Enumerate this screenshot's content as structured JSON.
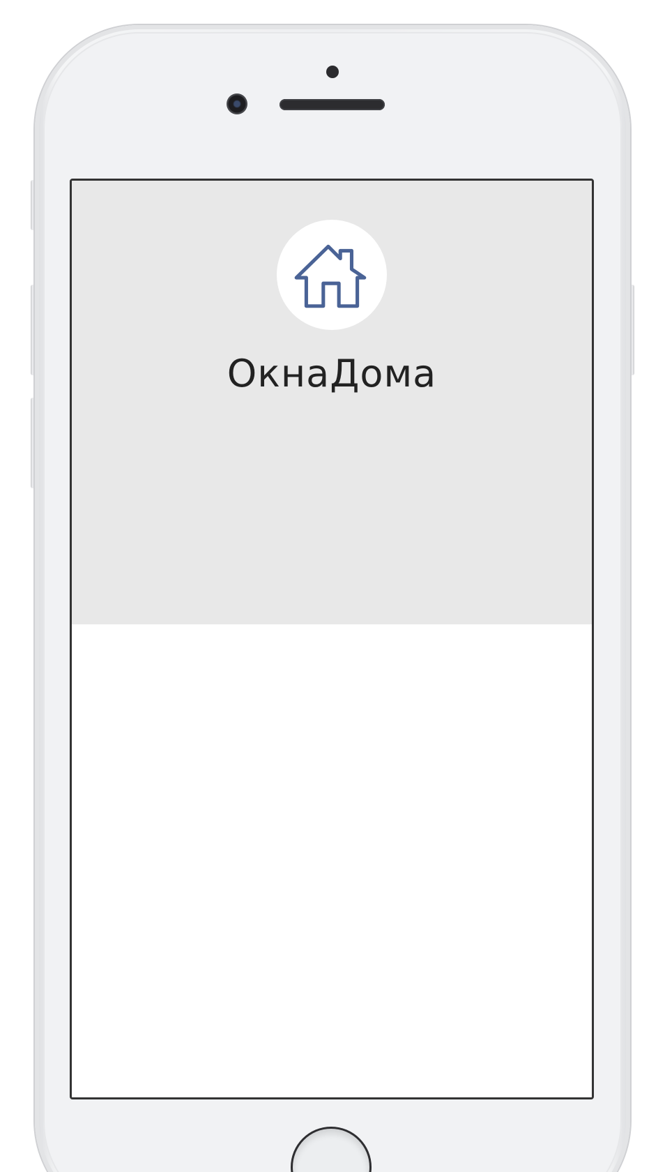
{
  "app": {
    "brand_name": "ОкнаДома",
    "logo_icon": "house-icon",
    "accent_color": "#4a6396",
    "header_background": "#e8e8e8"
  },
  "device": {
    "type": "phone-mockup",
    "home_button_icon": "home-button"
  }
}
